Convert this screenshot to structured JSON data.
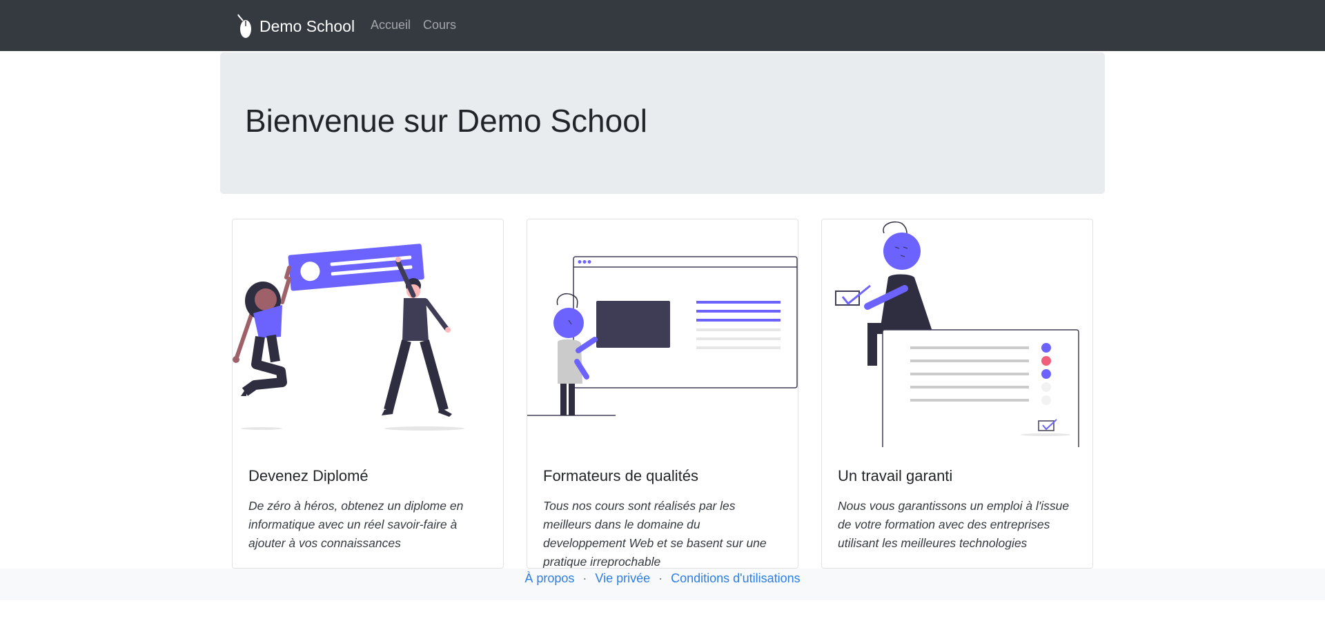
{
  "navbar": {
    "brand": "Demo School",
    "links": [
      {
        "label": "Accueil"
      },
      {
        "label": "Cours"
      }
    ]
  },
  "jumbotron": {
    "title": "Bienvenue sur Demo School"
  },
  "cards": [
    {
      "title": "Devenez Diplomé",
      "text": "De zéro à héros, obtenez un diplome en informatique avec un réel savoir-faire à ajouter à vos connaissances",
      "illustration": "graduation-illustration"
    },
    {
      "title": "Formateurs de qualités",
      "text": "Tous nos cours sont réalisés par les meilleurs dans le domaine du developpement Web et se basent sur une pratique irreprochable",
      "illustration": "teacher-illustration"
    },
    {
      "title": "Un travail garanti",
      "text": "Nous vous garantissons un emploi à l'issue de votre formation avec des entreprises utilisant les meilleures technologies",
      "illustration": "job-illustration"
    }
  ],
  "footer": {
    "links": [
      {
        "label": "À propos"
      },
      {
        "label": "Vie privée"
      },
      {
        "label": "Conditions d'utilisations"
      }
    ],
    "separator": "·"
  },
  "colors": {
    "navbar": "#343a40",
    "accent": "#6c63ff",
    "dark_figure": "#2f2e41",
    "link": "#2b7de9"
  }
}
